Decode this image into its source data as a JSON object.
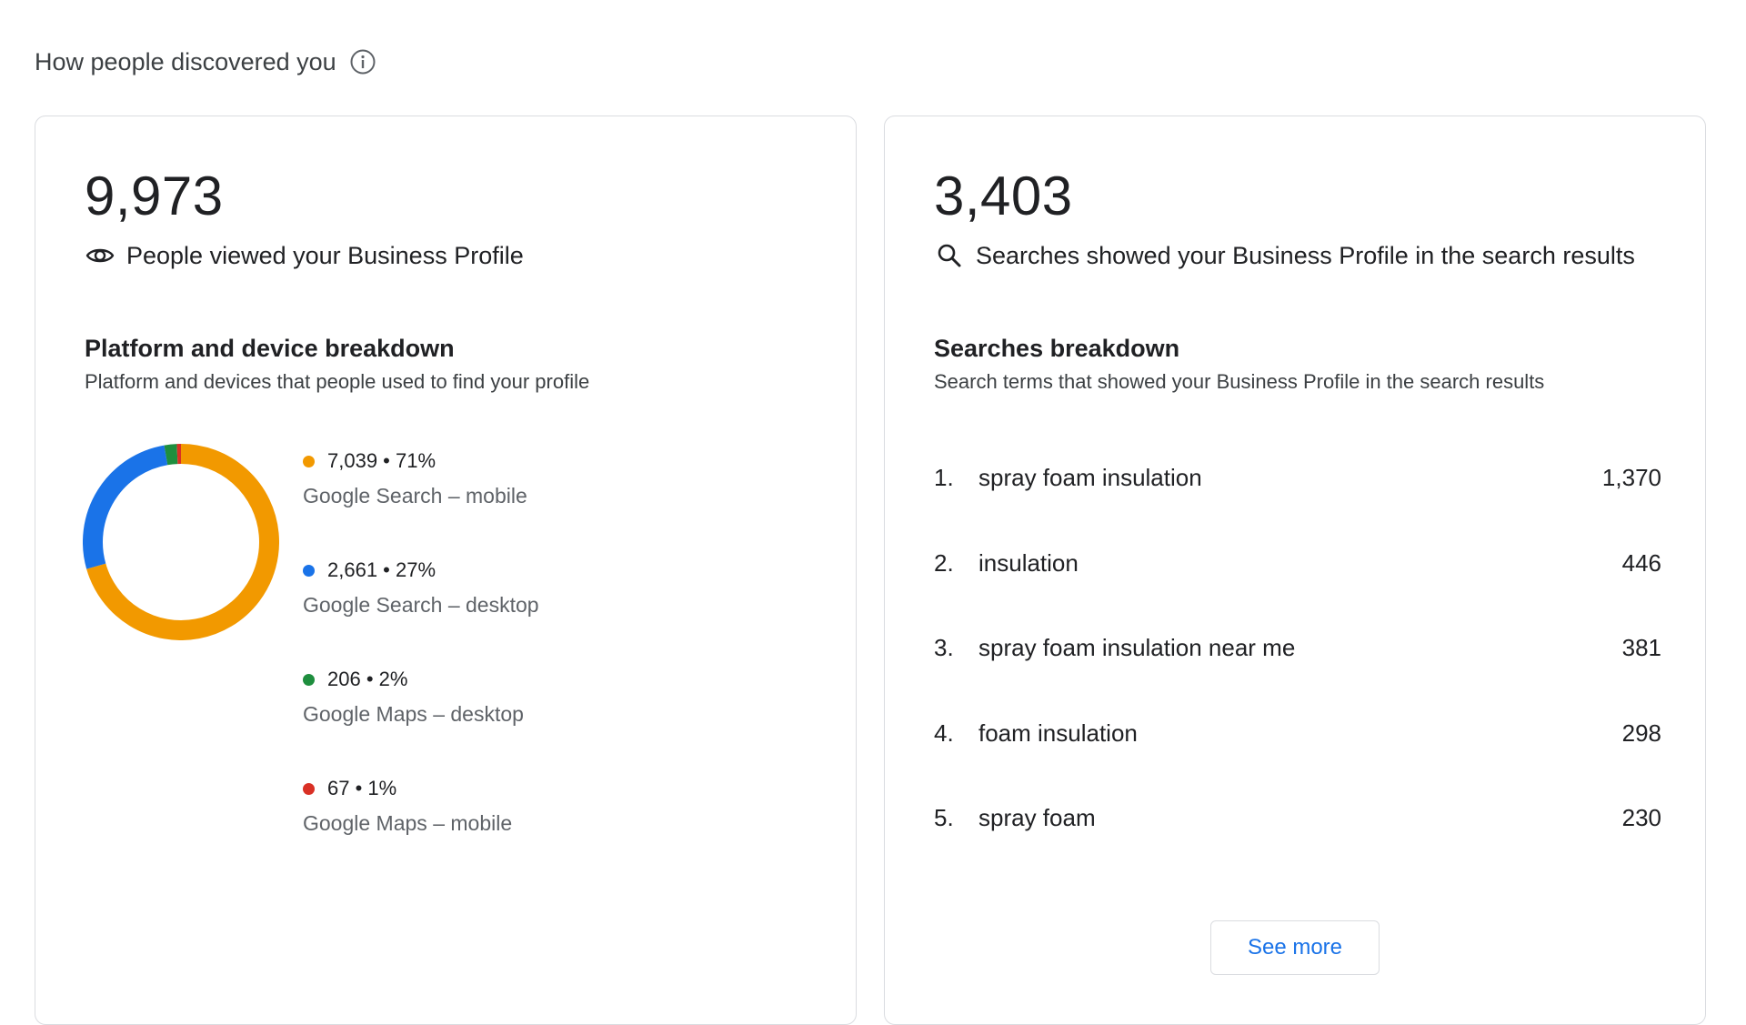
{
  "header": {
    "title": "How people discovered you",
    "info_icon": "info-icon"
  },
  "views_card": {
    "total": "9,973",
    "icon": "eye-icon",
    "label": "People viewed your Business Profile",
    "breakdown_title": "Platform and device breakdown",
    "breakdown_desc": "Platform and devices that people used to find your profile",
    "chart_data": {
      "type": "pie",
      "donut": true,
      "categories": [
        "Google Search – mobile",
        "Google Search – desktop",
        "Google Maps – desktop",
        "Google Maps – mobile"
      ],
      "values": [
        7039,
        2661,
        206,
        67
      ],
      "percents": [
        71,
        27,
        2,
        1
      ],
      "colors": [
        "#f29900",
        "#1a73e8",
        "#1e8e3e",
        "#d93025"
      ],
      "title": ""
    },
    "legend": [
      {
        "value": "7,039 • 71%",
        "label": "Google Search – mobile",
        "color": "#f29900"
      },
      {
        "value": "2,661 • 27%",
        "label": "Google Search – desktop",
        "color": "#1a73e8"
      },
      {
        "value": "206 • 2%",
        "label": "Google Maps – desktop",
        "color": "#1e8e3e"
      },
      {
        "value": "67 • 1%",
        "label": "Google Maps – mobile",
        "color": "#d93025"
      }
    ]
  },
  "searches_card": {
    "total": "3,403",
    "icon": "search-icon",
    "label": "Searches showed your Business Profile in the search results",
    "breakdown_title": "Searches breakdown",
    "breakdown_desc": "Search terms that showed your Business Profile in the search results",
    "items": [
      {
        "rank": "1.",
        "term": "spray foam insulation",
        "count": "1,370"
      },
      {
        "rank": "2.",
        "term": "insulation",
        "count": "446"
      },
      {
        "rank": "3.",
        "term": "spray foam insulation near me",
        "count": "381"
      },
      {
        "rank": "4.",
        "term": "foam insulation",
        "count": "298"
      },
      {
        "rank": "5.",
        "term": "spray foam",
        "count": "230"
      }
    ],
    "see_more_label": "See more"
  }
}
